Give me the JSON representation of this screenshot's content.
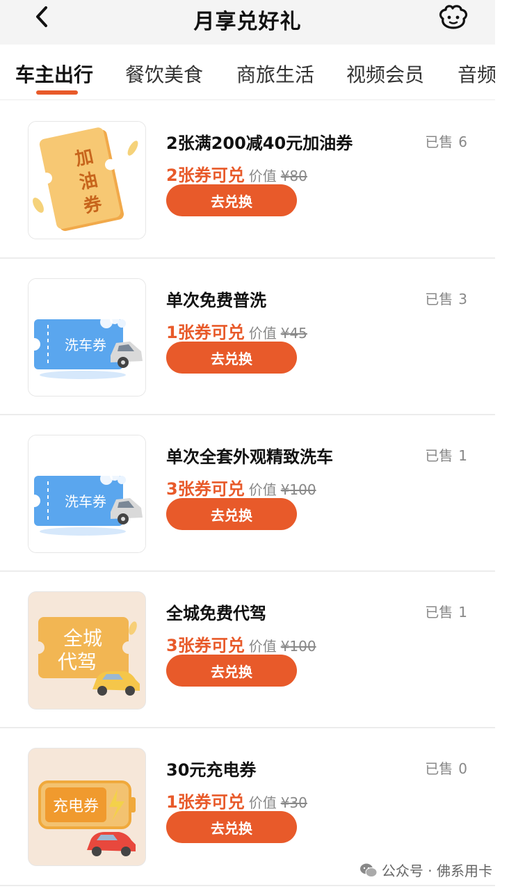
{
  "header": {
    "title": "月享兑好礼"
  },
  "tabs": [
    {
      "label": "车主出行"
    },
    {
      "label": "餐饮美食"
    },
    {
      "label": "商旅生活"
    },
    {
      "label": "视频会员"
    },
    {
      "label": "音频"
    }
  ],
  "items": [
    {
      "name": "2张满200减40元加油券",
      "sold_label": "已售",
      "sold_count": "6",
      "price_main": "2张券可兑",
      "price_label": "价值",
      "price_orig": "¥80",
      "button": "去兑换",
      "thumb_text": "加油券"
    },
    {
      "name": "单次免费普洗",
      "sold_label": "已售",
      "sold_count": "3",
      "price_main": "1张券可兑",
      "price_label": "价值",
      "price_orig": "¥45",
      "button": "去兑换",
      "thumb_text": "洗车券"
    },
    {
      "name": "单次全套外观精致洗车",
      "sold_label": "已售",
      "sold_count": "1",
      "price_main": "3张券可兑",
      "price_label": "价值",
      "price_orig": "¥100",
      "button": "去兑换",
      "thumb_text": "洗车券"
    },
    {
      "name": "全城免费代驾",
      "sold_label": "已售",
      "sold_count": "1",
      "price_main": "3张券可兑",
      "price_label": "价值",
      "price_orig": "¥100",
      "button": "去兑换",
      "thumb_text": "全城代驾"
    },
    {
      "name": "30元充电券",
      "sold_label": "已售",
      "sold_count": "0",
      "price_main": "1张券可兑",
      "price_label": "价值",
      "price_orig": "¥30",
      "button": "去兑换",
      "thumb_text": "充电券"
    }
  ],
  "watermark": {
    "text": "公众号 · 佛系用卡"
  },
  "colors": {
    "accent": "#e85a2a",
    "muted": "#888888",
    "divider": "#ececec",
    "header_bg": "#f4f4f4"
  }
}
